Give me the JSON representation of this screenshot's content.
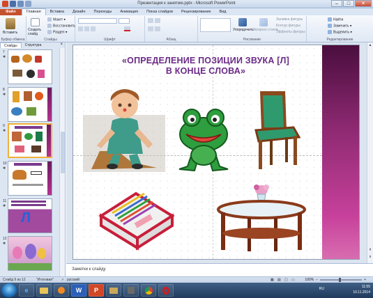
{
  "window": {
    "title": "Презентация к занятию.pptx - Microsoft PowerPoint",
    "controls": {
      "minimize": "–",
      "maximize": "□",
      "close": "✕"
    }
  },
  "ribbon_tabs": [
    "Файл",
    "Главная",
    "Вставка",
    "Дизайн",
    "Переходы",
    "Анимация",
    "Показ слайдов",
    "Рецензирование",
    "Вид"
  ],
  "ribbon": {
    "clipboard": {
      "paste": "Вставить",
      "label": "Буфер обмена"
    },
    "slides": {
      "new_slide": "Создать слайд",
      "layout": "Макет ▾",
      "reset": "Восстановить",
      "section": "Раздел ▾",
      "label": "Слайды"
    },
    "font": {
      "label": "Шрифт"
    },
    "paragraph": {
      "label": "Абзац"
    },
    "drawing": {
      "arrange": "Упорядочить",
      "quick_styles": "Экспресс-стили",
      "fill": "Заливка фигуры",
      "outline": "Контур фигуры",
      "effects": "Эффекты фигуры",
      "label": "Рисование"
    },
    "editing": {
      "find": "Найти",
      "replace": "Заменить ▾",
      "select": "Выделить ▾",
      "label": "Редактирование"
    }
  },
  "left_panel": {
    "tabs": [
      "Слайды",
      "Структура"
    ],
    "close": "×",
    "thumbnails": [
      {
        "number": "7",
        "star": "✱"
      },
      {
        "number": "8",
        "star": "✱"
      },
      {
        "number": "9",
        "star": "✱"
      },
      {
        "number": "10",
        "star": "✱"
      },
      {
        "number": "11",
        "star": "✱",
        "big_letter": "Л"
      },
      {
        "number": "12",
        "star": "✱"
      }
    ]
  },
  "slide": {
    "heading_line1": "«ОПРЕДЕЛЕНИЕ ПОЗИЦИИ ЗВУКА [Л]",
    "heading_line2": "В КОНЦЕ СЛОВА»"
  },
  "notes": {
    "placeholder": "Заметки к слайду"
  },
  "status": {
    "slide": "Слайд 9 из 12",
    "theme": "\"Итоговая\"",
    "language": "русский",
    "zoom": "100%"
  },
  "taskbar": {
    "word_letter": "W",
    "ppt_letter": "P",
    "lang": "RU",
    "time": "11:55",
    "date": "10.11.2014"
  },
  "colors": {
    "heading": "#6b2a86",
    "band_top": "#4a0e3e",
    "band_bottom": "#d86db0",
    "file_tab": "#c5502e"
  }
}
